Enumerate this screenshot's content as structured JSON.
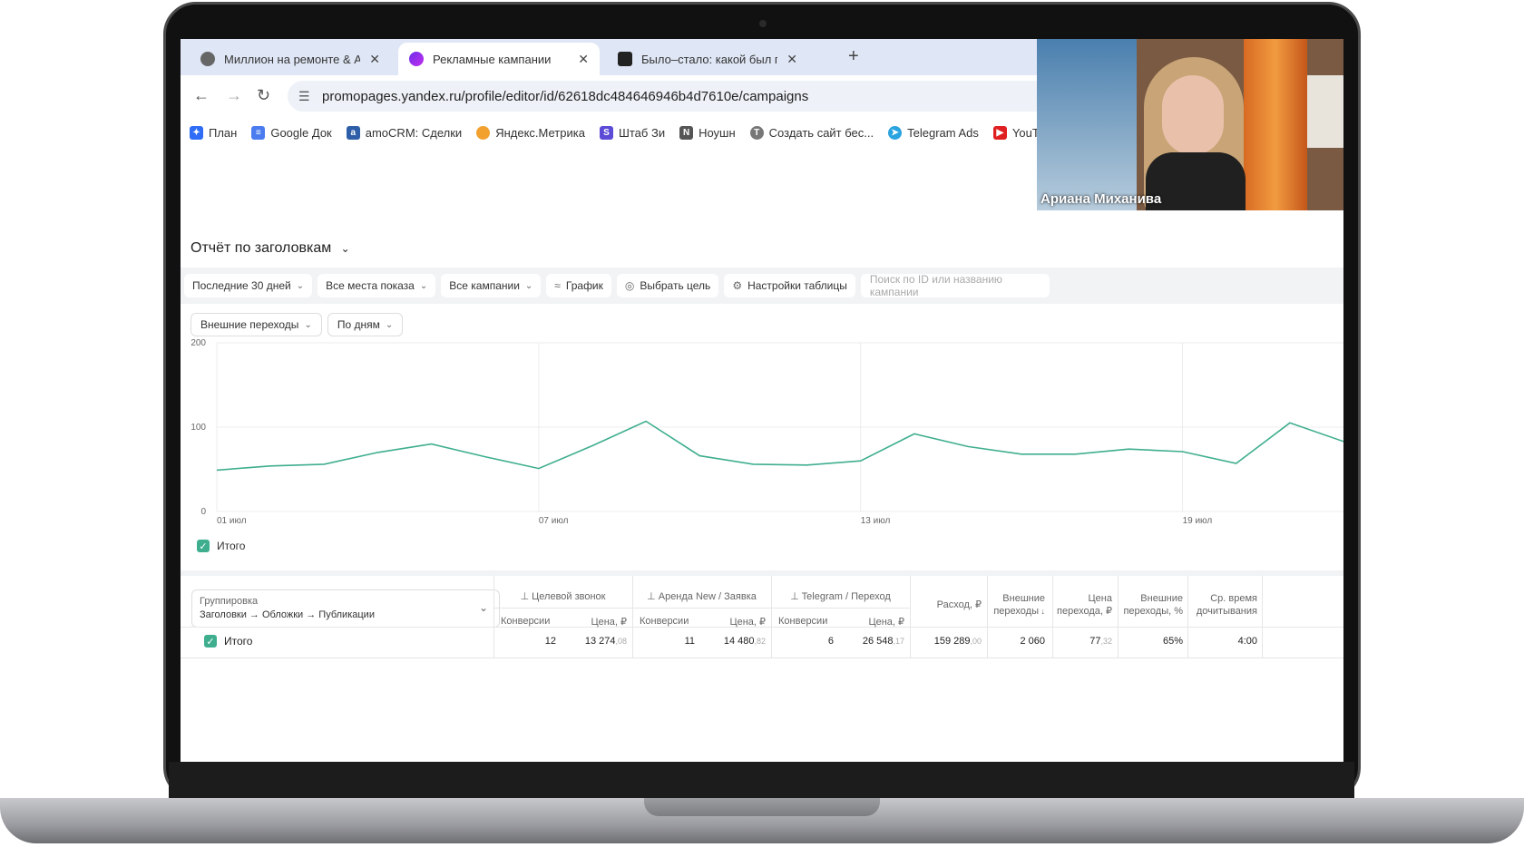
{
  "browser": {
    "tabs": [
      {
        "title": "Миллион на ремонте & АКМ",
        "active": false
      },
      {
        "title": "Рекламные кампании",
        "active": true
      },
      {
        "title": "Было–стало: какой был про",
        "active": false
      }
    ],
    "url": "promopages.yandex.ru/profile/editor/id/62618dc484646946b4d7610e/campaigns",
    "bookmarks": [
      {
        "label": "План",
        "icon": "plan-icon",
        "color": "#2f6df6"
      },
      {
        "label": "Google Док",
        "icon": "docs-icon",
        "color": "#4a7cf0"
      },
      {
        "label": "amoCRM: Сделки",
        "icon": "amocrm-icon",
        "color": "#2e5ea8"
      },
      {
        "label": "Яндекс.Метрика",
        "icon": "metrika-icon",
        "color": "#f2a02e"
      },
      {
        "label": "Штаб Зи",
        "icon": "shtab-icon",
        "color": "#5b4bd6"
      },
      {
        "label": "Ноушн",
        "icon": "notion-icon",
        "color": "#555555"
      },
      {
        "label": "Создать сайт бес...",
        "icon": "tilda-icon",
        "color": "#777777"
      },
      {
        "label": "Telegram Ads",
        "icon": "telegram-icon",
        "color": "#2aa3e0"
      },
      {
        "label": "YouT",
        "icon": "youtube-icon",
        "color": "#e02020"
      }
    ]
  },
  "report": {
    "title": "Отчёт по заголовкам",
    "filters": [
      "Последние 30 дней",
      "Все места показа",
      "Все кампании"
    ],
    "graph_label": "График",
    "goal_label": "Выбрать цель",
    "table_settings_label": "Настройки таблицы",
    "search_placeholder": "Поиск по ID или названию кампании",
    "metric_select": "Внешние переходы",
    "period_select": "По дням",
    "legend_label": "Итого"
  },
  "chart_data": {
    "type": "line",
    "x_ticks": [
      "01 июл",
      "07 июл",
      "13 июл",
      "19 июл"
    ],
    "y_ticks": [
      "0",
      "100",
      "200"
    ],
    "ylim": [
      0,
      200
    ],
    "series": [
      {
        "name": "Итого",
        "color": "#3fae8f",
        "values": [
          49,
          54,
          56,
          70,
          80,
          65,
          51,
          78,
          107,
          66,
          56,
          55,
          60,
          92,
          77,
          68,
          68,
          74,
          71,
          57,
          105,
          83
        ]
      }
    ]
  },
  "table": {
    "grouping_label": "Группировка",
    "grouping_value": "Заголовки → Обложки → Публикации",
    "goal_groups": [
      "Целевой звонок",
      "Аренда New / Заявка",
      "Telegram / Переход"
    ],
    "sub_headers": [
      "Конверсии",
      "Цена, ₽"
    ],
    "columns": {
      "spend": "Расход, ₽",
      "ext_clicks": "Внешние переходы",
      "click_price": "Цена перехода, ₽",
      "ext_rate": "Внешние переходы, %",
      "read_time": "Ср. время дочитывания"
    },
    "total_row": {
      "label": "Итого",
      "g1_conv": "12",
      "g1_price": "13 274",
      "g1_price_frac": ",08",
      "g2_conv": "11",
      "g2_price": "14 480",
      "g2_price_frac": ",82",
      "g3_conv": "6",
      "g3_price": "26 548",
      "g3_price_frac": ",17",
      "spend": "159 289",
      "spend_frac": ",00",
      "ext_clicks": "2 060",
      "click_price": "77",
      "click_price_frac": ",32",
      "ext_rate": "65%",
      "read_time": "4:00"
    }
  },
  "webcam": {
    "participant_name": "Ариана Миханива"
  }
}
